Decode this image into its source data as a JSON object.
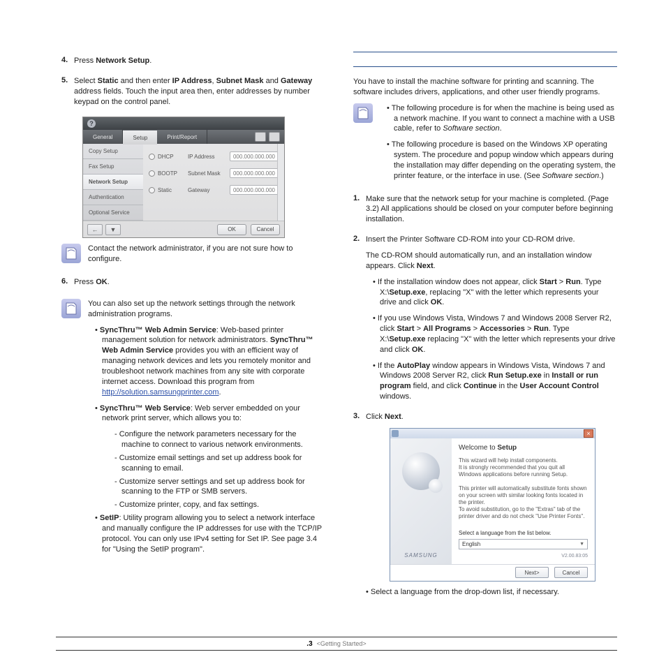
{
  "left": {
    "step4_pre": "Press ",
    "step4_b": "Network Setup",
    "step5_a": "Select ",
    "step5_b": "Static",
    "step5_c": " and then enter ",
    "step5_d": "IP Address",
    "step5_e": ", ",
    "step5_f": "Subnet Mask",
    "step5_g": " and ",
    "step5_h": "Gateway",
    "step5_i": " address fields. Touch the input area then, enter addresses by number keypad on the control panel.",
    "note1": "Contact the network administrator, if you are not sure how to configure.",
    "step6_a": "Press ",
    "step6_b": "OK",
    "note2a": "You can also set up the network settings through the network administration programs.",
    "bul1_b": "SyncThru™ Web Admin Service",
    "bul1_t": ": Web-based printer management solution for network administrators. ",
    "bul1_b2": "SyncThru™ Web Admin Service",
    "bul1_t2": " provides you with an efficient way of managing network devices and lets you remotely monitor and troubleshoot network machines from any site with corporate internet access. Download this program from ",
    "bul1_link": "http://solution.samsungprinter.com",
    "bul2_b": "SyncThru™ Web Service",
    "bul2_t": ": Web server embedded on your network print server, which allows you to:",
    "d1": "Configure the network parameters necessary for the machine to connect to various network environments.",
    "d2": "Customize email settings and set up address book for scanning to email.",
    "d3": "Customize server settings and set up address book for scanning to the FTP or SMB servers.",
    "d4": "Customize printer, copy, and fax settings.",
    "bul3_b": "SetIP",
    "bul3_t": ": Utility program allowing you to select a network interface and manually configure the IP addresses for use with the TCP/IP protocol. You can only use IPv4 setting for Set IP.  See  page 3.4 for \"Using the SetIP program\"."
  },
  "ui1": {
    "tabs": [
      "General",
      "Setup",
      "Print/Report"
    ],
    "side": [
      "Copy Setup",
      "Fax Setup",
      "Network Setup",
      "Authentication",
      "Optional Service"
    ],
    "radios": [
      "DHCP",
      "BOOTP",
      "Static"
    ],
    "fields": [
      {
        "lbl": "IP Address",
        "val": "000.000.000.000"
      },
      {
        "lbl": "Subnet Mask",
        "val": "000.000.000.000"
      },
      {
        "lbl": "Gateway",
        "val": "000.000.000.000"
      }
    ],
    "ok": "OK",
    "cancel": "Cancel"
  },
  "right": {
    "intro": "You have to install the machine software for printing and scanning. The software includes drivers, applications, and other user friendly programs.",
    "nb1a": "The following procedure is for when the machine is being used as a network machine. If you want to connect a machine with a USB cable, refer to ",
    "nb1b": "Software section",
    "nb2a": "The following procedure is based on the Windows XP operating system. The procedure and popup window which appears during the installation may differ depending on the operating system, the printer feature, or the interface in use. (See ",
    "nb2b": "Software section",
    "nb2c": ".)",
    "s1": "Make sure that the network setup for your machine is completed. (Page 3.2) All applications should be closed on your computer before beginning installation.",
    "s2": "Insert the Printer Software CD-ROM into your CD-ROM drive.",
    "s2b": "The CD-ROM should automatically run, and an installation window appears. Click ",
    "s2b_b": "Next",
    "b1a": "If the installation window does not appear, click ",
    "b1b": "Start",
    "b1c": " > ",
    "b1d": "Run",
    "b1e": ". Type X:\\",
    "b1f": "Setup.exe",
    "b1g": ", replacing \"X\" with the letter which represents your drive and click ",
    "b1h": "OK",
    "b2a": "If you use Windows Vista, Windows 7 and Windows 2008 Server R2, click ",
    "b2b": "Start",
    "b2c": " > ",
    "b2d": "All Programs",
    "b2e": " > ",
    "b2f": "Accessories",
    "b2g": " > ",
    "b2h": "Run",
    "b2i": ". Type X:\\",
    "b2j": "Setup.exe",
    "b2k": " replacing \"X\" with the letter which represents your drive and click ",
    "b2l": "OK",
    "b3a": "If the ",
    "b3b": "AutoPlay",
    "b3c": " window appears in Windows Vista, Windows 7 and Windows 2008 Server R2, click ",
    "b3d": "Run Setup.exe",
    "b3e": " in ",
    "b3f": "Install or run program",
    "b3g": " field, and click ",
    "b3h": "Continue",
    "b3i": " in the ",
    "b3j": "User Account Control",
    "b3k": " windows.",
    "s3a": "Click ",
    "s3b": "Next",
    "after": "• Select a language from the drop-down list, if necessary."
  },
  "ui2": {
    "title_a": "Welcome to ",
    "title_b": "                                          ",
    "title_c": " Setup",
    "p1a": "This wizard will help install ",
    "p1b": "                                    ",
    "p1c": " components.",
    "p1d": "It is strongly recommended that you quit all Windows applications before running Setup.",
    "p2": "This printer will automatically substitute fonts shown on your screen with similar looking fonts located in the printer.\nTo avoid substitution, go to the \"Extras\" tab of the printer driver and do not check \"Use Printer Fonts\".",
    "sel_lbl": "Select a language from the list below.",
    "sel_val": "English",
    "ver": "V2.00.83:05",
    "brand": "SAMSUNG",
    "next": "Next>",
    "cancel": "Cancel"
  },
  "footer": {
    "page": ".3",
    "section": "<Getting Started>"
  }
}
